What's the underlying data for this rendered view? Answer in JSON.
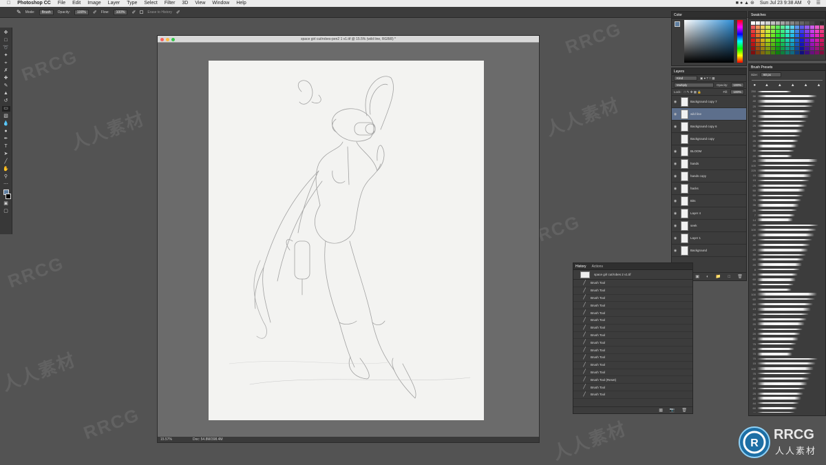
{
  "menubar": {
    "app": "Photoshop CC",
    "items": [
      "File",
      "Edit",
      "Image",
      "Layer",
      "Type",
      "Select",
      "Filter",
      "3D",
      "View",
      "Window",
      "Help"
    ],
    "clock": "Sun Jul 23  9:38 AM"
  },
  "options": {
    "mode_label": "Mode:",
    "mode_value": "Brush",
    "opacity_label": "Opacity:",
    "opacity_value": "100%",
    "flow_label": "Flow:",
    "flow_value": "100%",
    "erase_history": "Erase to History"
  },
  "document": {
    "title": "space girl cut/robes-pen2 1 v1.tif @ 15.5% (wild line, RGB/8) *",
    "zoom": "15.57%",
    "doc_size": "Doc: 54.8M/398.4M"
  },
  "color_panel": {
    "tab": "Color"
  },
  "swatches_panel": {
    "tab": "Swatches"
  },
  "layers_panel": {
    "tab": "Layers",
    "kind": "Kind",
    "blend": "Multiply",
    "opacity_label": "Opacity:",
    "opacity": "100%",
    "lock_label": "Lock:",
    "fill_label": "Fill:",
    "fill": "100%",
    "layers": [
      {
        "name": "Background copy 7",
        "visible": true,
        "selected": false
      },
      {
        "name": "wild line",
        "visible": true,
        "selected": true
      },
      {
        "name": "Background copy 6",
        "visible": true,
        "selected": false
      },
      {
        "name": "Background copy",
        "visible": false,
        "selected": false
      },
      {
        "name": "BLOOM",
        "visible": true,
        "selected": false
      },
      {
        "name": "hands",
        "visible": true,
        "selected": false
      },
      {
        "name": "hands copy",
        "visible": true,
        "selected": false
      },
      {
        "name": "hacks",
        "visible": true,
        "selected": false
      },
      {
        "name": "Bits",
        "visible": true,
        "selected": false
      },
      {
        "name": "Layer 4",
        "visible": true,
        "selected": false
      },
      {
        "name": "seek",
        "visible": true,
        "selected": false
      },
      {
        "name": "Layer 1",
        "visible": true,
        "selected": false
      },
      {
        "name": "Background",
        "visible": true,
        "selected": false
      }
    ]
  },
  "history_panel": {
    "tabs": [
      "History",
      "Actions"
    ],
    "snapshot": "space girl cut/robes 2 v1.tif",
    "items": [
      "Brush Tool",
      "Brush Tool",
      "Brush Tool",
      "Brush Tool",
      "Brush Tool",
      "Brush Tool",
      "Brush Tool",
      "Brush Tool",
      "Brush Tool",
      "Brush Tool",
      "Brush Tool",
      "Brush Tool",
      "Brush Tool",
      "Brush Tool (Reset)",
      "Brush Tool",
      "Brush Tool"
    ]
  },
  "brush_panel": {
    "tab": "Brush Presets",
    "size_label": "Size:",
    "size_value": "60 px",
    "sizes": [
      "250",
      "30",
      "40",
      "25",
      "25",
      "50",
      "25",
      "25",
      "50",
      "50",
      "25",
      "30",
      "30",
      "20",
      "25",
      "100",
      "225",
      "15",
      "15",
      "25",
      "50",
      "60",
      "75",
      "35",
      "25",
      "7",
      "14",
      "65",
      "100",
      "40",
      "40",
      "40",
      "25",
      "30",
      "60",
      "20",
      "8",
      "50",
      "60",
      "50",
      "60",
      "100",
      "60",
      "60",
      "13",
      "20",
      "35",
      "20",
      "6",
      "20",
      "60",
      "75",
      "50",
      "70",
      "70",
      "15",
      "100",
      "75",
      "80",
      "20",
      "15",
      "25",
      "40",
      "44",
      "60",
      "40",
      "10",
      "30",
      "100"
    ]
  },
  "watermarks": {
    "brand": "RRCG",
    "cn": "人人素材",
    "logo_cn": "人人素材"
  }
}
